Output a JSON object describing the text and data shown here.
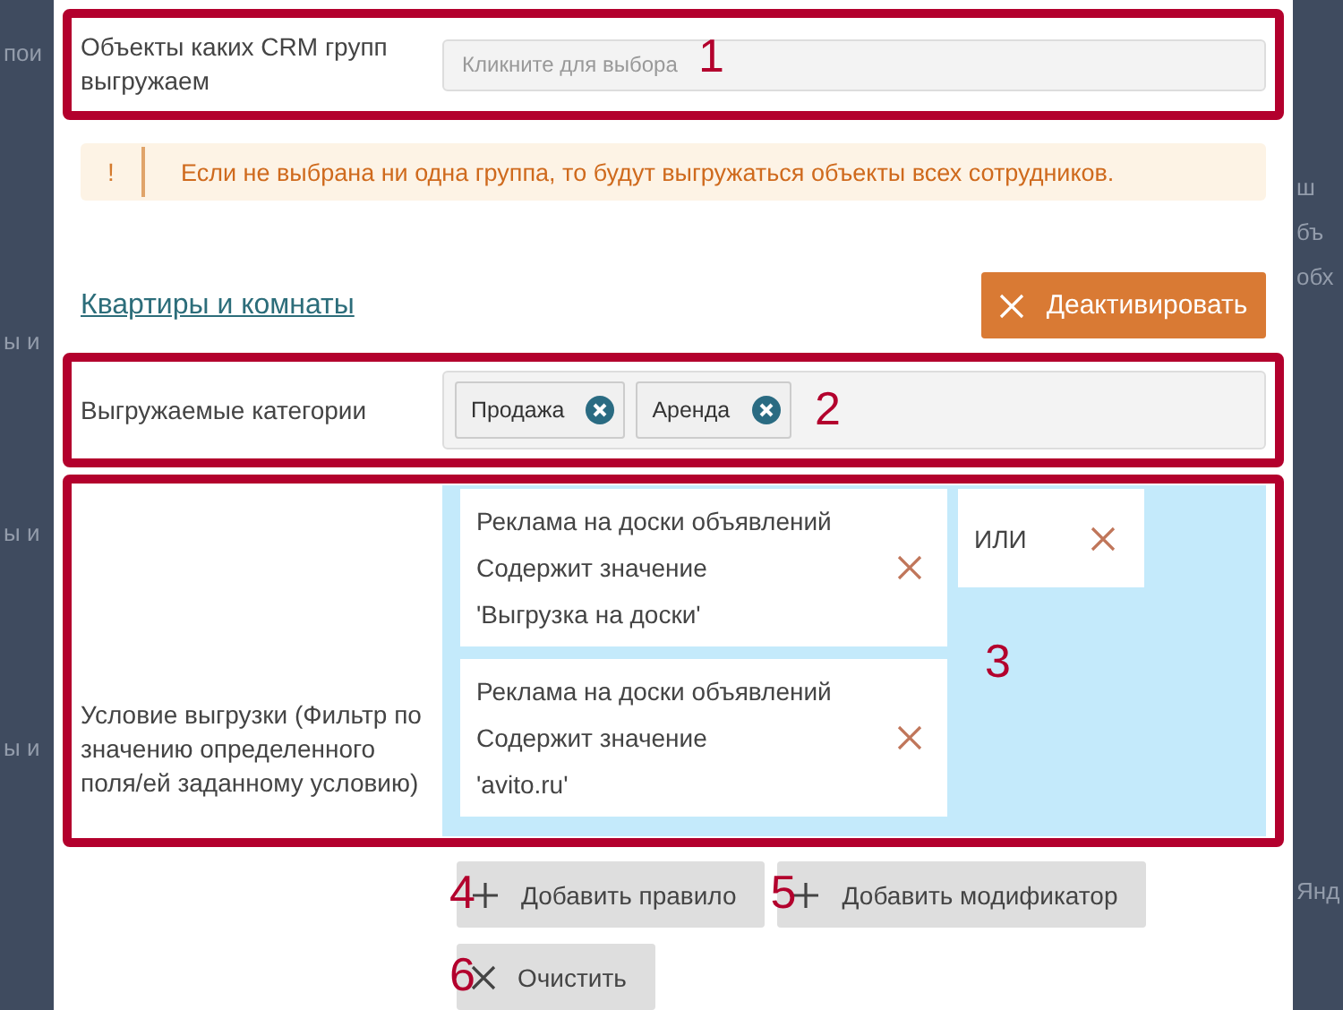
{
  "background_left": [
    "пои",
    "ы и",
    "ы и",
    "ы и"
  ],
  "background_right": [
    "ш",
    "бъ",
    "обх",
    "Янд"
  ],
  "crm_groups": {
    "label": "Объекты каких CRM групп выгружаем",
    "placeholder": "Кликните для выбора",
    "marker": "1"
  },
  "alert": {
    "icon": "!",
    "text": "Если не выбрана ни одна группа, то будут выгружаться объекты всех сотрудников."
  },
  "section": {
    "link": "Квартиры и комнаты",
    "button": "Деактивировать"
  },
  "categories": {
    "label": "Выгружаемые категории",
    "marker": "2",
    "tags": [
      {
        "label": "Продажа"
      },
      {
        "label": "Аренда"
      }
    ]
  },
  "condition": {
    "label": "Условие выгрузки (Фильтр по значению определенного поля/ей заданному условию)",
    "marker": "3",
    "operator": "ИЛИ",
    "rules": [
      {
        "lines": [
          "Реклама на доски объявлений",
          "Содержит значение",
          "'Выгрузка на доски'"
        ]
      },
      {
        "lines": [
          "Реклама на доски объявлений",
          "Содержит значение",
          "'avito.ru'"
        ]
      }
    ]
  },
  "buttons": [
    {
      "kind": "add",
      "label": "Добавить правило",
      "marker": "4"
    },
    {
      "kind": "add",
      "label": "Добавить модификатор",
      "marker": "5"
    },
    {
      "kind": "clear",
      "label": "Очистить",
      "marker": "6"
    }
  ]
}
